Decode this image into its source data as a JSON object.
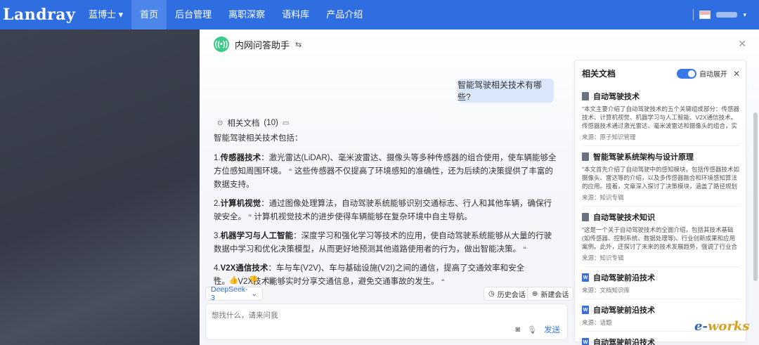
{
  "nav": {
    "logo": "Landray",
    "items": [
      {
        "label": "蓝博士 ▾"
      },
      {
        "label": "首页"
      },
      {
        "label": "后台管理"
      },
      {
        "label": "离职深察"
      },
      {
        "label": "语料库"
      },
      {
        "label": "产品介绍"
      }
    ]
  },
  "chat": {
    "title": "内网问答助手",
    "user_question": "智能驾驶相关技术有哪些?",
    "related_label": "相关文档",
    "related_count": "(10)",
    "intro": "智能驾驶相关技术包括：",
    "points": [
      {
        "num": "1.",
        "term": "传感器技术",
        "text": "：激光雷达(LiDAR)、毫米波雷达、摄像头等多种传感器的组合使用，使车辆能够全方位感知周围环境。",
        "cite1": "❝",
        "text2": "这些传感器不仅提高了环境感知的准确性，还为后续的决策提供了丰富的数据支持。",
        "cite2": ""
      },
      {
        "num": "2.",
        "term": "计算机视觉",
        "text": "：通过图像处理算法，自动驾驶系统能够识别交通标志、行人和其他车辆，确保行驶安全。",
        "cite1": "❝",
        "text2": "计算机视觉技术的进步使得车辆能够在复杂环境中自主导航。",
        "cite2": ""
      },
      {
        "num": "3.",
        "term": "机器学习与人工智能",
        "text": "：深度学习和强化学习等技术的应用，使自动驾驶系统能够从大量的行驶数据中学习和优化决策模型，从而更好地预测其他道路使用者的行为，做出智能决策。",
        "cite1": "❝",
        "text2": "",
        "cite2": ""
      },
      {
        "num": "4.",
        "term": "V2X通信技术",
        "text": "：车与车(V2V)、车与基础设施(V2I)之间的通信，提高了交通效率和安全性。",
        "cite1": "❝",
        "text2": "V2X技术能够实时分享交通信息，避免交通事故的发生。",
        "cite2": "❝"
      }
    ],
    "model": "DeepSeek-3",
    "history_label": "历史会话",
    "new_label": "新建会话",
    "input_placeholder": "想找什么，请来问我",
    "send_label": "发送"
  },
  "docs": {
    "title": "相关文档",
    "auto_expand": "自动展开",
    "items": [
      {
        "icon": "file",
        "title": "自动驾驶技术",
        "summary": "\"本文主要介绍了自动驾驶技术的五个关键组成部分：传感器技术、计算机视觉、机器学习与人工智能、V2X通信技术。传感器技术通过激光雷达、毫米波雷达和摄像头的组合，实现全方位环境感知",
        "source": "来源：原子知识管理"
      },
      {
        "icon": "file",
        "title": "智能驾驶系统架构与设计原理",
        "summary": "\"本文首先介绍了自动驾驶中的感知模块，包括传感器技术如摄像头、雷达等的介绍，以及多传感器融合和环境感知算法的应用。接着，文章深入探讨了决策模块，涵盖了路径规划的原理、行为决",
        "source": "来源：知识专辑"
      },
      {
        "icon": "file",
        "title": "自动驾驶技术知识",
        "summary": "\"这是一个关于自动驾驶技术的全面介绍，包括其技术基础(如传感器、控制系统、数据处理等)、行业创新成果和应用案例。此外，还探讨了未来的技术发展趋势，强调了行业合作与标准化在推动",
        "source": "来源：知识专辑"
      },
      {
        "icon": "word",
        "title": "自动驾驶前沿技术",
        "summary": "",
        "source": "来源：文档知识库"
      },
      {
        "icon": "word",
        "title": "自动驾驶前沿技术",
        "summary": "",
        "source": "来源：话题"
      },
      {
        "icon": "word",
        "title": "自动驾驶前沿技术",
        "summary": "",
        "source": ""
      }
    ]
  },
  "watermark": {
    "a": "e-",
    "b": "works"
  },
  "colors": {
    "nav": "#2f6ee0",
    "accent": "#3b78e7",
    "bubble": "#dbe7fb",
    "bot": "#3dc98a"
  }
}
